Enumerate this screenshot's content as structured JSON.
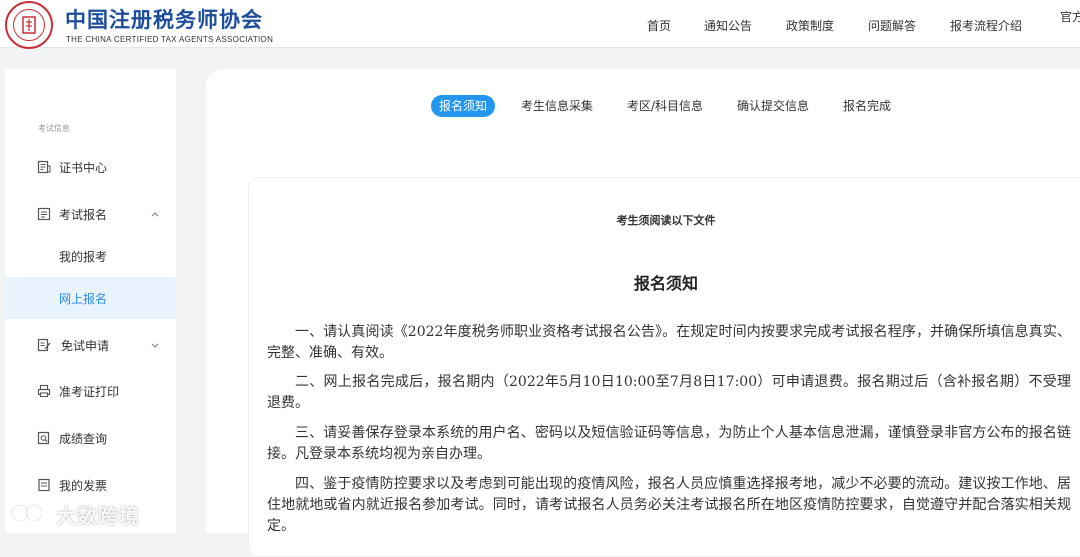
{
  "header": {
    "logo_title": "中国注册税务师协会",
    "logo_subtitle": "THE CHINA CERTIFIED TAX AGENTS ASSOCIATION",
    "nav": [
      "首页",
      "通知公告",
      "政策制度",
      "问题解答",
      "报考流程介绍",
      "官方"
    ]
  },
  "sidebar": {
    "group_label": "考试信息",
    "items": [
      {
        "label": "证书中心",
        "icon": "certificate-icon"
      },
      {
        "label": "考试报名",
        "icon": "form-icon"
      },
      {
        "label": "免试申请",
        "icon": "edit-icon"
      },
      {
        "label": "准考证打印",
        "icon": "printer-icon"
      },
      {
        "label": "成绩查询",
        "icon": "search-doc-icon"
      },
      {
        "label": "我的发票",
        "icon": "invoice-icon"
      }
    ],
    "sub_items": [
      {
        "label": "我的报考"
      },
      {
        "label": "网上报名"
      }
    ]
  },
  "steps": [
    "报名须知",
    "考生信息采集",
    "考区/科目信息",
    "确认提交信息",
    "报名完成"
  ],
  "notice": {
    "heading": "考生须阅读以下文件",
    "title": "报名须知",
    "paragraphs": [
      "一、请认真阅读《2022年度税务师职业资格考试报名公告》。在规定时间内按要求完成考试报名程序，并确保所填信息真实、完整、准确、有效。",
      "二、网上报名完成后，报名期内（2022年5月10日10:00至7月8日17:00）可申请退费。报名期过后（含补报名期）不受理退费。",
      "三、请妥善保存登录本系统的用户名、密码以及短信验证码等信息，为防止个人基本信息泄漏，谨慎登录非官方公布的报名链接。凡登录本系统均视为亲自办理。",
      "四、鉴于疫情防控要求以及考虑到可能出现的疫情风险，报名人员应慎重选择报考地，减少不必要的流动。建议按工作地、居住地就地或省内就近报名参加考试。同时，请考试报名人员务必关注考试报名所在地区疫情防控要求，自觉遵守并配合落实相关规定。"
    ]
  },
  "watermark": {
    "text": "大数跨境"
  },
  "colors": {
    "accent": "#2396ef",
    "brand_blue": "#1d4e9e",
    "seal_red": "#c8313a",
    "active_bg": "#e8f3fd"
  }
}
